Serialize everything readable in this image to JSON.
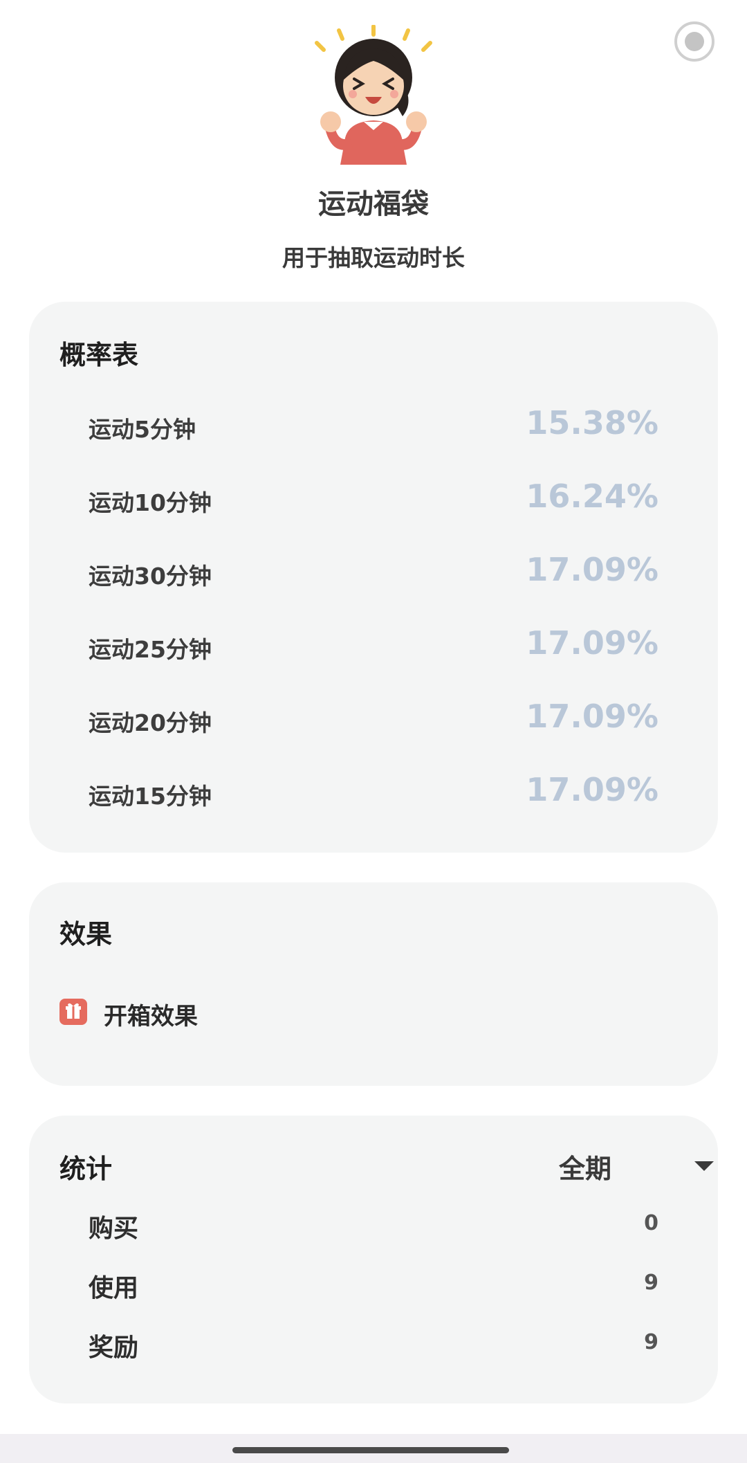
{
  "header": {
    "title": "运动福袋",
    "subtitle": "用于抽取运动时长",
    "illustration_icon": "excited-girl-illustration",
    "radio_icon": "radio-button-icon"
  },
  "probability": {
    "title": "概率表",
    "rows": [
      {
        "label": "运动5分钟",
        "value": "15.38%"
      },
      {
        "label": "运动10分钟",
        "value": "16.24%"
      },
      {
        "label": "运动30分钟",
        "value": "17.09%"
      },
      {
        "label": "运动25分钟",
        "value": "17.09%"
      },
      {
        "label": "运动20分钟",
        "value": "17.09%"
      },
      {
        "label": "运动15分钟",
        "value": "17.09%"
      }
    ],
    "value_color": "#b9c7d8"
  },
  "effect": {
    "title": "效果",
    "item_label": "开箱效果",
    "item_icon": "gift-icon",
    "icon_color": "#e56b5e"
  },
  "stats": {
    "title": "统计",
    "period": "全期",
    "rows": [
      {
        "label": "购买",
        "value": "0"
      },
      {
        "label": "使用",
        "value": "9"
      },
      {
        "label": "奖励",
        "value": "9"
      }
    ]
  }
}
